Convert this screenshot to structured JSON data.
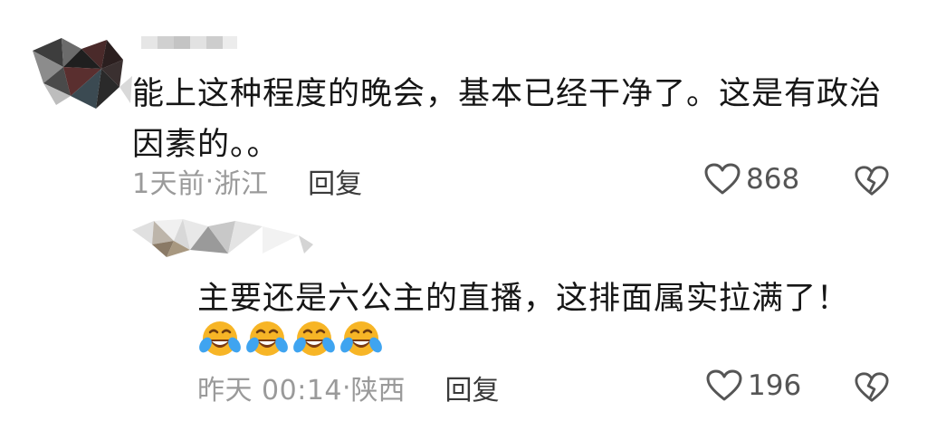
{
  "comments": [
    {
      "text": "能上这种程度的晚会，基本已经干净了。这是有政治因素的。。",
      "time": "1天前",
      "location": "浙江",
      "reply_label": "回复",
      "likes": "868",
      "avatar": "mosaic-pixelated-avatar",
      "username": ""
    },
    {
      "text": "主要还是六公主的直播，这排面属实拉满了！",
      "emojis": [
        "laughing-crying-emoji",
        "laughing-crying-emoji",
        "laughing-crying-emoji",
        "laughing-crying-emoji"
      ],
      "time": "昨天 00:14",
      "location": "陕西",
      "reply_label": "回复",
      "likes": "196",
      "avatar": "mosaic-pixelated-avatar",
      "username": ""
    }
  ],
  "separator": " · ",
  "icons": {
    "like": "heart-outline-icon",
    "dislike": "broken-heart-icon"
  },
  "colors": {
    "text": "#161616",
    "meta": "#9a9a9a",
    "reply": "#3a3a3a",
    "icon": "#555555",
    "emoji_face": "#f7b526"
  }
}
